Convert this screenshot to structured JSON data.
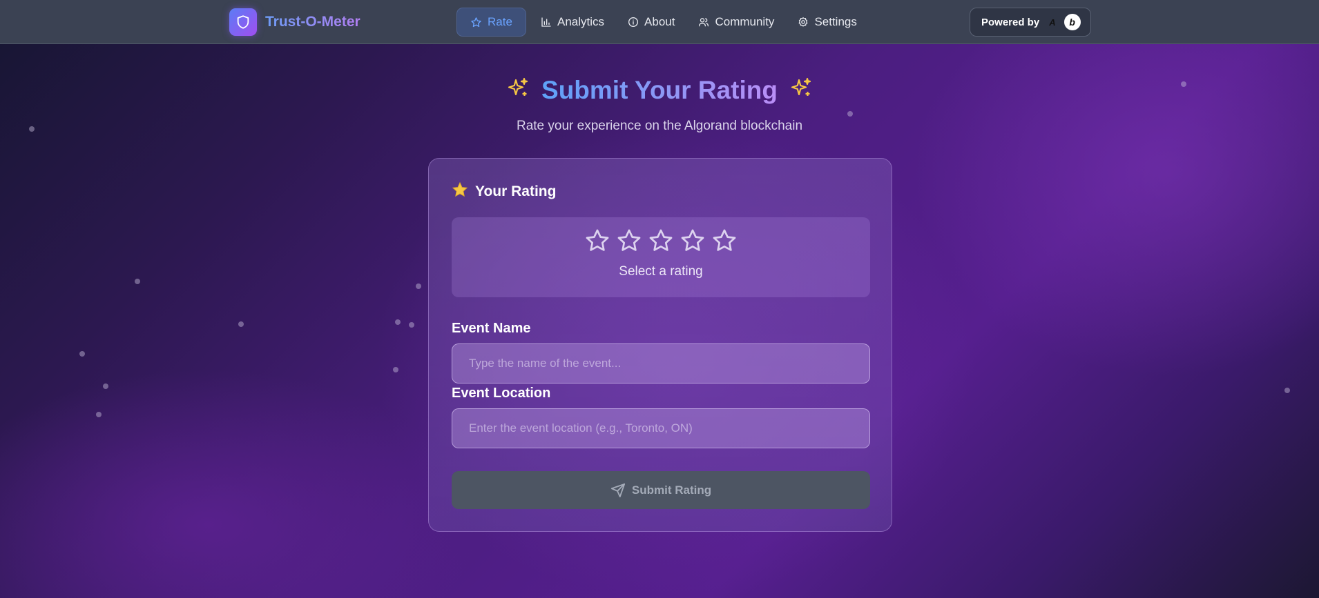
{
  "brand": {
    "name": "Trust-O-Meter",
    "logo_icon": "shield-icon"
  },
  "nav": {
    "items": [
      {
        "label": "Rate",
        "icon": "star-icon",
        "active": true
      },
      {
        "label": "Analytics",
        "icon": "bar-chart-icon",
        "active": false
      },
      {
        "label": "About",
        "icon": "info-icon",
        "active": false
      },
      {
        "label": "Community",
        "icon": "users-icon",
        "active": false
      },
      {
        "label": "Settings",
        "icon": "gear-icon",
        "active": false
      }
    ]
  },
  "powered_by": {
    "label": "Powered by",
    "logos": [
      "algorand-logo",
      "b-logo"
    ]
  },
  "hero": {
    "title": "Submit Your Rating",
    "subtitle": "Rate your experience on the Algorand blockchain"
  },
  "rating_card": {
    "heading": "Your Rating",
    "stars_total": 5,
    "stars_selected": 0,
    "hint": "Select a rating",
    "event_name": {
      "label": "Event Name",
      "placeholder": "Type the name of the event...",
      "value": ""
    },
    "event_location": {
      "label": "Event Location",
      "placeholder": "Enter the event location (e.g., Toronto, ON)",
      "value": ""
    },
    "submit_label": "Submit Rating"
  },
  "colors": {
    "accent_blue": "#6aa3ff",
    "accent_purple": "#b17ef2",
    "star_gold": "#f6c744",
    "submit_disabled": "#4d5563"
  }
}
